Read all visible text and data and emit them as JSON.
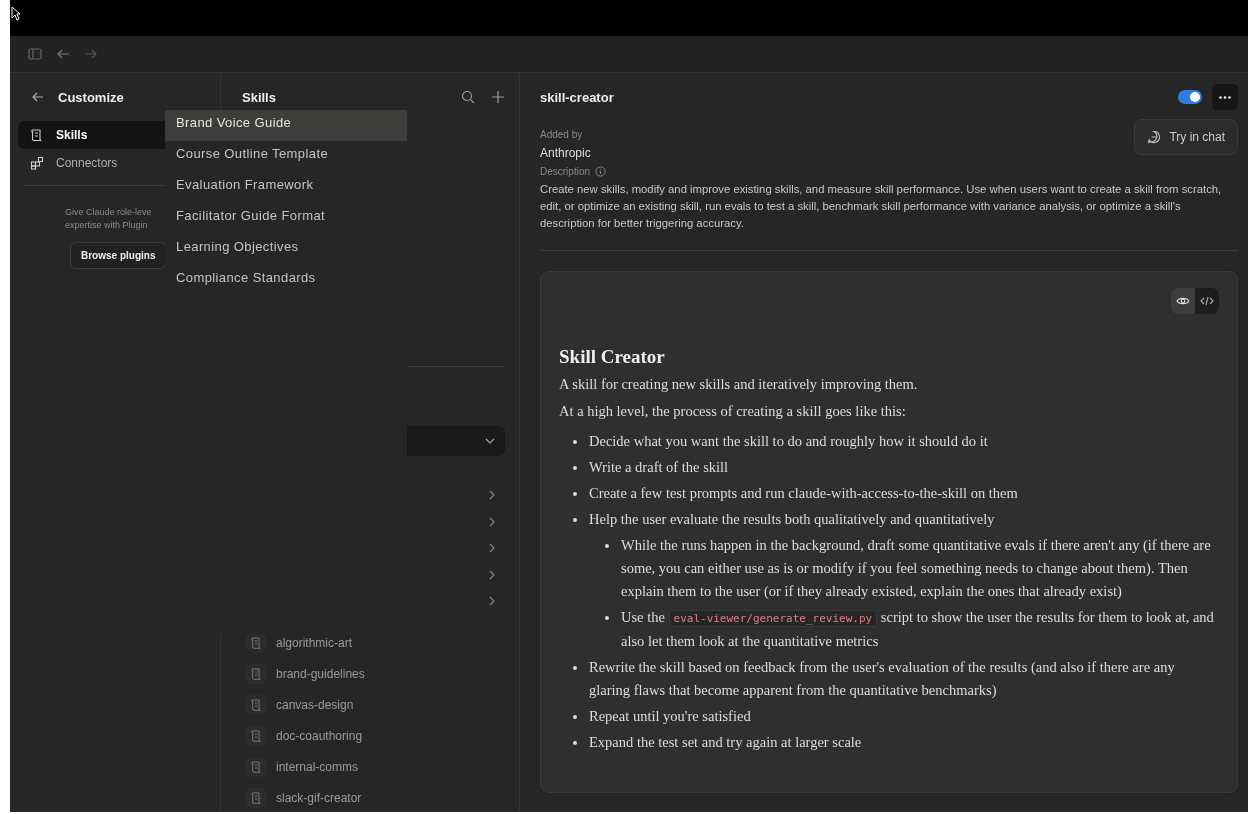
{
  "customize": {
    "title": "Customize",
    "nav": [
      {
        "label": "Skills",
        "kind": "skills",
        "selected": true
      },
      {
        "label": "Connectors",
        "kind": "connectors",
        "selected": false
      }
    ],
    "promo_lines": [
      "Give Claude role-leve",
      "expertise with Plugin"
    ],
    "browse_button": "Browse plugins"
  },
  "skills_panel": {
    "title": "Skills",
    "skills": [
      "algorithmic-art",
      "brand-guidelines",
      "canvas-design",
      "doc-coauthoring",
      "internal-comms",
      "slack-gif-creator"
    ]
  },
  "suggestions": [
    {
      "label": "Brand Voice Guide",
      "selected": true
    },
    {
      "label": "Course Outline Template",
      "selected": false
    },
    {
      "label": "Evaluation Framework",
      "selected": false
    },
    {
      "label": "Facilitator Guide Format",
      "selected": false
    },
    {
      "label": "Learning Objectives",
      "selected": false
    },
    {
      "label": "Compliance Standards",
      "selected": false
    }
  ],
  "detail": {
    "title": "skill-creator",
    "enabled": true,
    "menu_item": "Try in chat",
    "added_by_label": "Added by",
    "added_by": "Anthropic",
    "description_label": "Description",
    "description": "Create new skills, modify and improve existing skills, and measure skill performance. Use when users want to create a skill from scratch, edit, or optimize an existing skill, run evals to test a skill, benchmark skill performance with variance analysis, or optimize a skill's description for better triggering accuracy.",
    "view_modes": [
      {
        "kind": "preview",
        "selected": true
      },
      {
        "kind": "code",
        "selected": false
      }
    ],
    "document": {
      "heading": "Skill Creator",
      "paragraphs": [
        "A skill for creating new skills and iteratively improving them.",
        "At a high level, the process of creating a skill goes like this:"
      ],
      "list": [
        {
          "parts": [
            {
              "kind": "text",
              "text": "Decide what you want the skill to do and roughly how it should do it"
            }
          ]
        },
        {
          "parts": [
            {
              "kind": "text",
              "text": "Write a draft of the skill"
            }
          ]
        },
        {
          "parts": [
            {
              "kind": "text",
              "text": "Create a few test prompts and run claude-with-access-to-the-skill on them"
            }
          ]
        },
        {
          "parts": [
            {
              "kind": "text",
              "text": "Help the user evaluate the results both qualitatively and quantitatively"
            }
          ],
          "children": [
            {
              "parts": [
                {
                  "kind": "text",
                  "text": "While the runs happen in the background, draft some quantitative evals if there aren't any (if there are some, you can either use as is or modify if you feel something needs to change about them). Then explain them to the user (or if they already existed, explain the ones that already exist)"
                }
              ]
            },
            {
              "parts": [
                {
                  "kind": "text",
                  "text": "Use the "
                },
                {
                  "kind": "code",
                  "text": "eval-viewer/generate_review.py"
                },
                {
                  "kind": "text",
                  "text": " script to show the user the results for them to look at, and also let them look at the quantitative metrics"
                }
              ]
            }
          ]
        },
        {
          "parts": [
            {
              "kind": "text",
              "text": "Rewrite the skill based on feedback from the user's evaluation of the results (and also if there are any glaring flaws that become apparent from the quantitative benchmarks)"
            }
          ]
        },
        {
          "parts": [
            {
              "kind": "text",
              "text": "Repeat until you're satisfied"
            }
          ]
        },
        {
          "parts": [
            {
              "kind": "text",
              "text": "Expand the test set and try again at larger scale"
            }
          ]
        }
      ]
    }
  }
}
